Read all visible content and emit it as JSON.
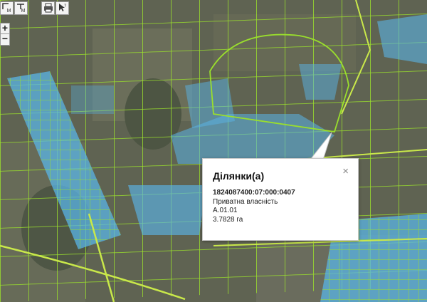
{
  "toolbar": {
    "measure_area_label": "M",
    "measure_distance_label": "M",
    "print_tool": "printer-icon",
    "identify_tool": "cursor-question-icon"
  },
  "zoom": {
    "in_label": "+",
    "out_label": "−"
  },
  "popup": {
    "title": "Ділянки(а)",
    "close_label": "×",
    "cadastral_number": "1824087400:07:000:0407",
    "ownership": "Приватна власність",
    "purpose_code": "A.01.01",
    "area": "3.7828 га"
  },
  "colors": {
    "parcel_border": "#9adf2c",
    "parcel_fill": "#5ab4e6",
    "road": "#c9e84a"
  }
}
